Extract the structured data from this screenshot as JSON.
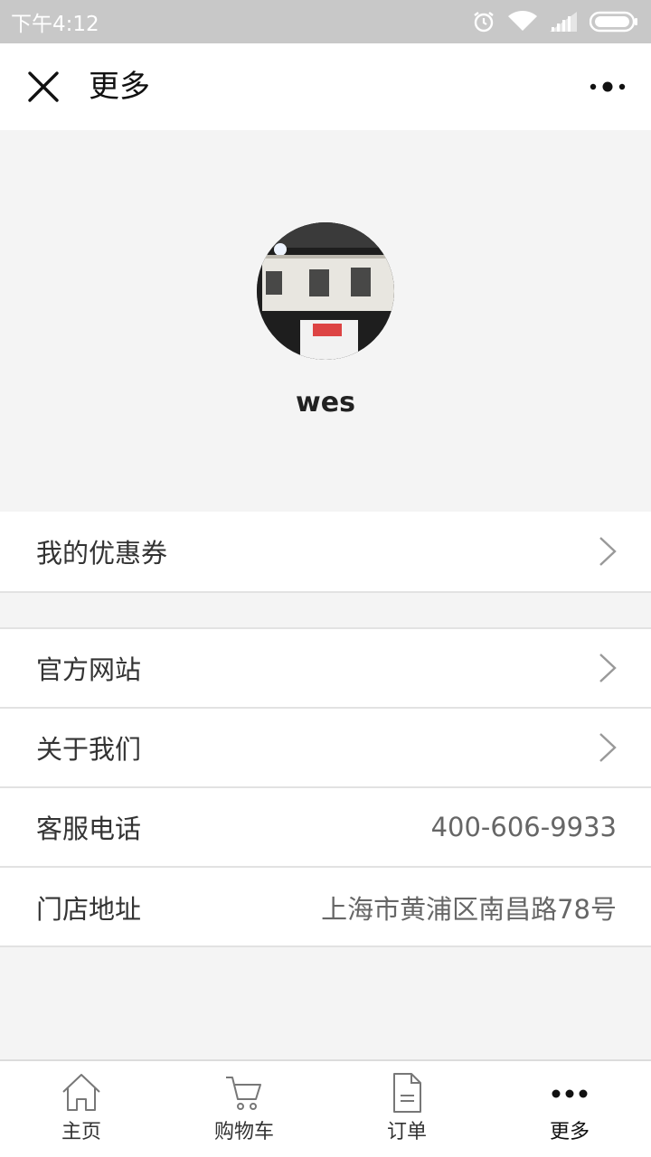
{
  "status_bar": {
    "time": "下午4:12",
    "icons": [
      "alarm-icon",
      "wifi-icon",
      "signal-icon",
      "battery-icon"
    ]
  },
  "nav": {
    "title": "更多",
    "close_icon": "close-icon",
    "more_icon": "more-options-icon"
  },
  "profile": {
    "username": "wes"
  },
  "menu_group_1": [
    {
      "label": "我的优惠券",
      "icon": "chevron-right-icon"
    }
  ],
  "menu_group_2": [
    {
      "label": "官方网站",
      "icon": "chevron-right-icon"
    },
    {
      "label": "关于我们",
      "icon": "chevron-right-icon"
    },
    {
      "label": "客服电话",
      "value": "400-606-9933"
    },
    {
      "label": "门店地址",
      "value": "上海市黄浦区南昌路78号"
    }
  ],
  "tab_bar": [
    {
      "label": "主页",
      "icon": "home-icon"
    },
    {
      "label": "购物车",
      "icon": "cart-icon"
    },
    {
      "label": "订单",
      "icon": "document-icon"
    },
    {
      "label": "更多",
      "icon": "more-icon",
      "active": true
    }
  ],
  "colors": {
    "status_bar_bg": "#c8c8c8",
    "page_bg": "#f4f4f4",
    "divider": "#e2e2e2"
  }
}
